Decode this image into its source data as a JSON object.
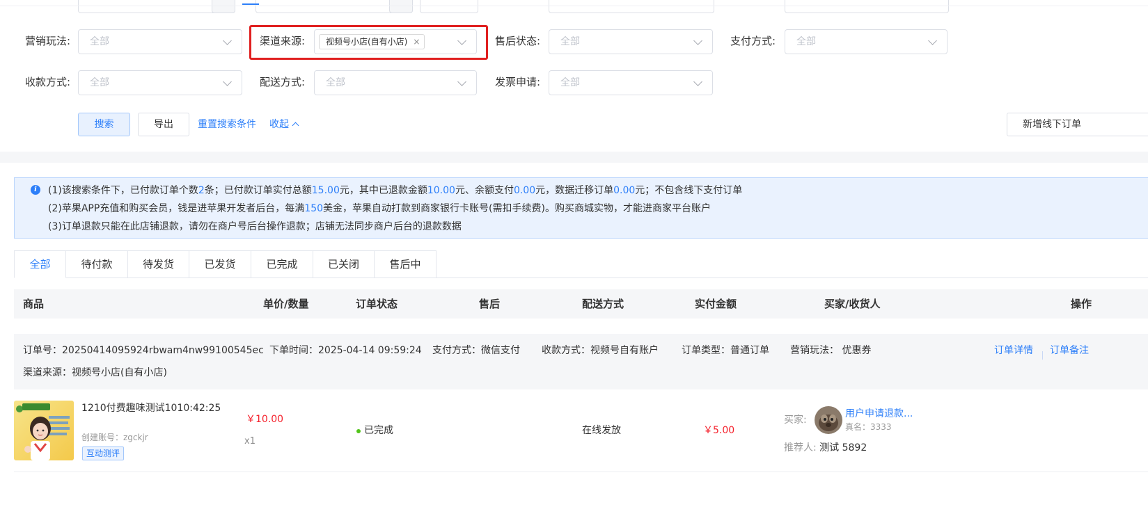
{
  "filters": {
    "marketing_play": {
      "label": "营销玩法:",
      "placeholder": "全部"
    },
    "channel_source": {
      "label": "渠道来源:",
      "selected_tag": "视频号小店(自有小店)",
      "tag_close": "×"
    },
    "after_sale_status": {
      "label": "售后状态:",
      "placeholder": "全部"
    },
    "payment_method": {
      "label": "支付方式:",
      "placeholder": "全部"
    },
    "collection_method": {
      "label": "收款方式:",
      "placeholder": "全部"
    },
    "delivery_method": {
      "label": "配送方式:",
      "placeholder": "全部"
    },
    "invoice_request": {
      "label": "发票申请:",
      "placeholder": "全部"
    }
  },
  "actions": {
    "search": "搜索",
    "export": "导出",
    "reset": "重置搜索条件",
    "collapse": "收起",
    "new_offline_order": "新增线下订单"
  },
  "info_banner": {
    "line1": {
      "t1": "(1)该搜索条件下，已付款订单个数",
      "paid_count": "2",
      "t2": "条；已付款订单实付总额",
      "paid_total": "15.00",
      "t3": "元，其中已退款金额",
      "refunded": "10.00",
      "t4": "元、余额支付",
      "balance_paid": "0.00",
      "t5": "元，数据迁移订单",
      "migrated": "0.00",
      "t6": "元；不包含线下支付订单"
    },
    "line2": {
      "t1": "(2)苹果APP充值和购买会员，钱是进苹果开发者后台，每满",
      "threshold": "150",
      "t2": "美金，苹果自动打款到商家银行卡账号(需扣手续费)。购买商城实物，才能进商家平台账户"
    },
    "line3": "(3)订单退款只能在此店铺退款，请勿在商户号后台操作退款；店铺无法同步商户后台的退款数据"
  },
  "status_tabs": [
    "全部",
    "待付款",
    "待发货",
    "已发货",
    "已完成",
    "已关闭",
    "售后中"
  ],
  "table_headers": {
    "product": "商品",
    "unit_price_qty": "单价/数量",
    "order_status": "订单状态",
    "after_sale": "售后",
    "delivery": "配送方式",
    "paid_amount": "实付金额",
    "buyer_receiver": "买家/收货人",
    "actions": "操作"
  },
  "order": {
    "order_no": "订单号：20250414095924rbwam4nw99100545ec",
    "order_time": "下单时间：2025-04-14 09:59:24",
    "payment_method": "支付方式：微信支付",
    "collection_method": "收款方式：视频号自有账户",
    "order_type": "订单类型：普通订单",
    "marketing_play": "营销玩法： 优惠券",
    "channel_source": "渠道来源：视频号小店(自有小店)",
    "detail_link": "订单详情",
    "note_link": "订单备注",
    "item": {
      "name": "1210付费趣味测试1010:42:25",
      "creator": "创建账号：zgckjr",
      "badge": "互动测评",
      "unit_price": "￥10.00",
      "quantity": "x1",
      "status": "已完成",
      "delivery": "在线发放",
      "paid_amount": "￥5.00",
      "buyer_label": "买家:",
      "buyer_name": "用户申请退款...",
      "real_name": "真名：3333",
      "referrer_label": "推荐人:",
      "referrer_value": "测试 5892"
    }
  },
  "colors": {
    "accent": "#2d7ff9",
    "highlight_border": "#e02020",
    "price": "#f5222d",
    "status_dot": "#52c41a"
  }
}
